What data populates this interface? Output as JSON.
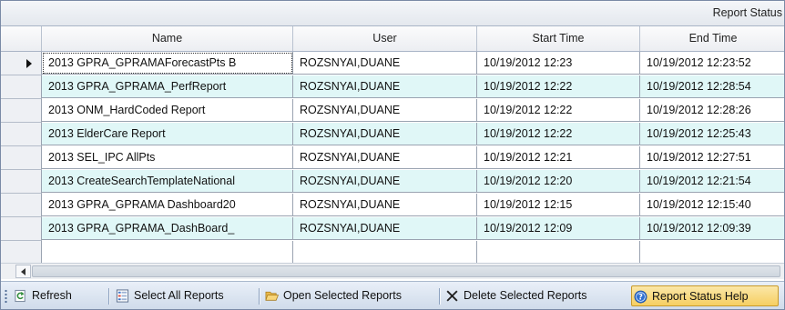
{
  "caption": "Report Status",
  "columns": [
    "Name",
    "User",
    "Start Time",
    "End Time"
  ],
  "rows": [
    {
      "name": "2013 GPRA_GPRAMAForecastPts B",
      "user": "ROZSNYAI,DUANE",
      "start": "10/19/2012 12:23",
      "end": "10/19/2012 12:23:52"
    },
    {
      "name": "2013 GPRA_GPRAMA_PerfReport",
      "user": "ROZSNYAI,DUANE",
      "start": "10/19/2012 12:22",
      "end": "10/19/2012 12:28:54"
    },
    {
      "name": "2013 ONM_HardCoded Report",
      "user": "ROZSNYAI,DUANE",
      "start": "10/19/2012 12:22",
      "end": "10/19/2012 12:28:26"
    },
    {
      "name": "2013 ElderCare Report",
      "user": "ROZSNYAI,DUANE",
      "start": "10/19/2012 12:22",
      "end": "10/19/2012 12:25:43"
    },
    {
      "name": "2013 SEL_IPC AllPts",
      "user": "ROZSNYAI,DUANE",
      "start": "10/19/2012 12:21",
      "end": "10/19/2012 12:27:51"
    },
    {
      "name": "2013 CreateSearchTemplateNational",
      "user": "ROZSNYAI,DUANE",
      "start": "10/19/2012 12:20",
      "end": "10/19/2012 12:21:54"
    },
    {
      "name": "2013 GPRA_GPRAMA Dashboard20",
      "user": "ROZSNYAI,DUANE",
      "start": "10/19/2012 12:15",
      "end": "10/19/2012 12:15:40"
    },
    {
      "name": "2013 GPRA_GPRAMA_DashBoard_",
      "user": "ROZSNYAI,DUANE",
      "start": "10/19/2012 12:09",
      "end": "10/19/2012 12:09:39"
    }
  ],
  "toolbar": {
    "refresh": "Refresh",
    "select_all": "Select All Reports",
    "open_selected": "Open Selected Reports",
    "delete_selected": "Delete Selected Reports",
    "help": "Report Status Help"
  },
  "icons": {
    "refresh": "refresh-icon",
    "select_all": "checklist-icon",
    "open_selected": "folder-open-icon",
    "delete_selected": "delete-x-icon",
    "help": "help-icon"
  },
  "colors": {
    "alt_row": "#e0f7f7",
    "toolbar_bg": "#dbe5f2",
    "help_highlight": "#f6cf62"
  }
}
